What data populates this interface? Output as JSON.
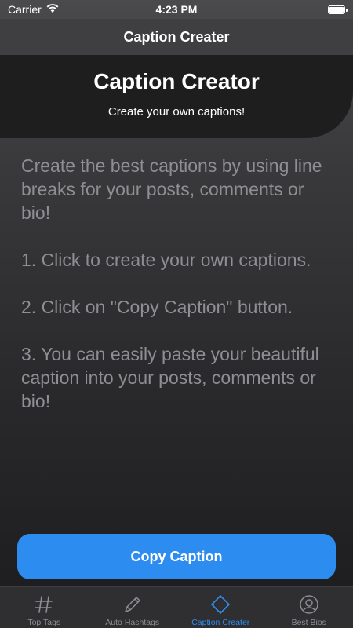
{
  "status_bar": {
    "carrier": "Carrier",
    "time": "4:23 PM"
  },
  "nav": {
    "title": "Caption Creater"
  },
  "header": {
    "title": "Caption Creator",
    "subtitle": "Create your own captions!"
  },
  "content": {
    "paragraphs": [
      "Create the best captions by using line breaks for your posts, comments or bio!",
      "1. Click to create your own captions.",
      "2. Click on \"Copy Caption\" button.",
      "3. You can easily paste your beautiful caption into your posts, comments or bio!"
    ]
  },
  "copy_button": {
    "label": "Copy Caption"
  },
  "tab_bar": {
    "items": [
      {
        "label": "Top Tags",
        "icon": "hashtag-icon",
        "active": false
      },
      {
        "label": "Auto Hashtags",
        "icon": "pencil-icon",
        "active": false
      },
      {
        "label": "Caption Creater",
        "icon": "diamond-icon",
        "active": true
      },
      {
        "label": "Best Bios",
        "icon": "user-circle-icon",
        "active": false
      }
    ]
  },
  "colors": {
    "accent": "#2d8cf0",
    "inactive": "#8e8e93",
    "header_bg": "#1e1e1e",
    "content_text": "#8e8e93"
  }
}
